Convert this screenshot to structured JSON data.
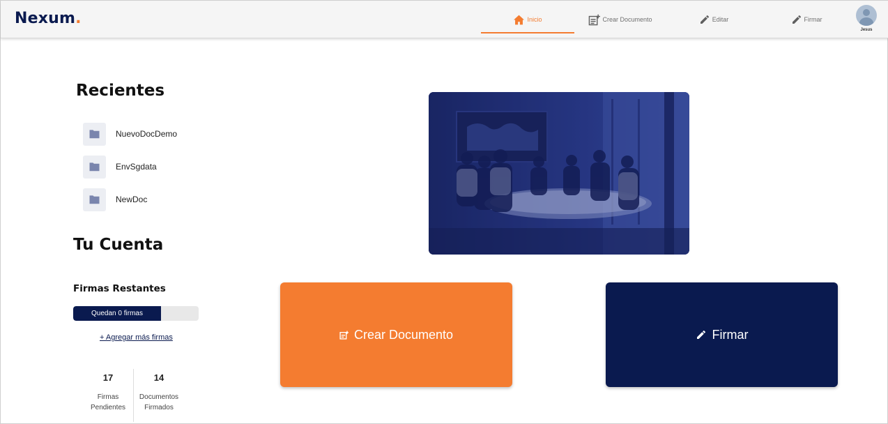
{
  "brand": {
    "name": "Nexum",
    "dot": ".",
    "accent": "#f47c30",
    "primary": "#0a1a4f"
  },
  "nav": {
    "items": [
      {
        "label": "Inicio",
        "icon": "home-icon",
        "active": true
      },
      {
        "label": "Crear Documento",
        "icon": "note-add-icon",
        "active": false
      },
      {
        "label": "Editar",
        "icon": "pencil-icon",
        "active": false
      },
      {
        "label": "Firmar",
        "icon": "pencil-icon",
        "active": false
      }
    ],
    "user": {
      "name": "Jesus",
      "icon": "avatar-icon"
    }
  },
  "recientes": {
    "title": "Recientes",
    "items": [
      {
        "label": "NuevoDocDemo",
        "icon": "folder-icon"
      },
      {
        "label": "EnvSgdata",
        "icon": "folder-icon"
      },
      {
        "label": "NewDoc",
        "icon": "folder-icon"
      }
    ]
  },
  "cuenta": {
    "title": "Tu Cuenta",
    "firmas_title": "Firmas Restantes",
    "firmas_bar_label": "Quedan 0 firmas",
    "add_link": "+ Agregar más firmas",
    "stats": [
      {
        "value": "17",
        "label": "Firmas Pendientes"
      },
      {
        "value": "14",
        "label": "Documentos Firmados"
      }
    ]
  },
  "actions": {
    "crear": {
      "label": "Crear Documento",
      "icon": "note-add-icon",
      "color": "#f47c30"
    },
    "firmar": {
      "label": "Firmar",
      "icon": "pencil-icon",
      "color": "#0a1a4f"
    }
  }
}
